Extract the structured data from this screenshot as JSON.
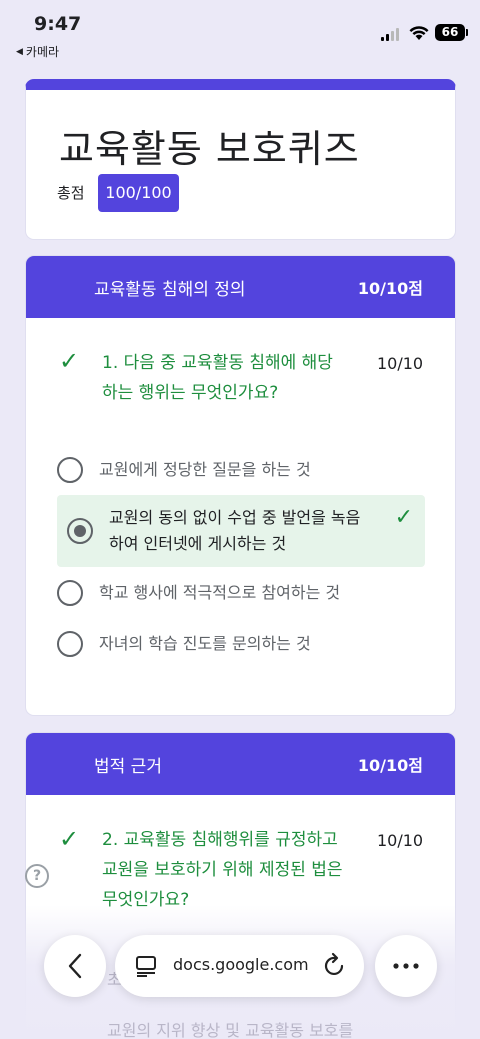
{
  "status": {
    "time": "9:47",
    "back_label": "카메라",
    "battery": "66"
  },
  "quiz": {
    "title": "교육활동 보호퀴즈",
    "score_label": "총점",
    "score": "100/100"
  },
  "sections": [
    {
      "title": "교육활동 침해의 정의",
      "score": "10/10점",
      "question": {
        "text_line1": "1. 다음 중 교육활동 침해에 해당",
        "text_line2": "하는 행위는 무엇인가요?",
        "points": "10/10"
      },
      "options": [
        {
          "text": "교원에게 정당한 질문을 하는 것",
          "selected": false
        },
        {
          "text_line1": "교원의 동의 없이 수업 중 발언을 녹음",
          "text_line2": "하여 인터넷에 게시하는 것",
          "selected": true
        },
        {
          "text": "학교 행사에 적극적으로 참여하는 것",
          "selected": false
        },
        {
          "text": "자녀의 학습 진도를 문의하는 것",
          "selected": false
        }
      ]
    },
    {
      "title": "법적 근거",
      "score": "10/10점",
      "question": {
        "text_line1": "2.  교육활동 침해행위를 규정하고",
        "text_line2": "교원을 보호하기 위해 제정된 법은",
        "text_line3": "무엇인가요?",
        "points": "10/10"
      },
      "partial_option_1": "초",
      "partial_option_2": "교원의 지위 향상 및 교육활동 보호를"
    }
  ],
  "browser": {
    "url": "docs.google.com"
  },
  "colors": {
    "accent": "#5344dd",
    "correct": "#1e8e3e",
    "correct_bg": "#e6f4ea"
  }
}
